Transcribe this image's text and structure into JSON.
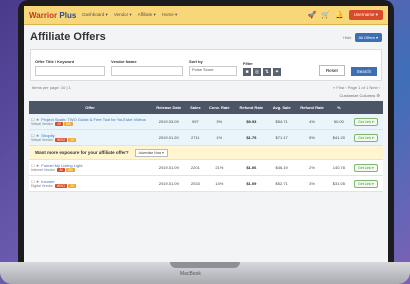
{
  "app": {
    "logo_part1": "Warrior",
    "logo_part2": "Plus",
    "nav": [
      "Dashboard ▾",
      "Vendor ▾",
      "Affiliate ▾",
      "Home ▾"
    ],
    "user_button": "Username ▾"
  },
  "page": {
    "title": "Affiliate Offers",
    "hide_label": "Hide",
    "all_offers_button": "All Offers ▾"
  },
  "filters": {
    "title_label": "Offer Title / Keyword",
    "vendor_label": "Vendor Name",
    "sort_label": "Sort by",
    "sort_value": "Pulse Score",
    "filter_label": "Filter",
    "filter_icons": [
      "■",
      "◎",
      "⇅",
      "✦"
    ],
    "reset_label": "Reset",
    "search_label": "Search"
  },
  "pager": {
    "left": "Items per page:  10  |  1",
    "right": "« First  ‹  Page 1 of 1  Next ›"
  },
  "column_toggle": "Customize Columns ⚙",
  "table": {
    "headers": [
      "Offer",
      "Release Date",
      "Sales",
      "Conv. Rate",
      "Refund Rate",
      "Avg. Sale",
      "Refund Rate",
      "%",
      ""
    ],
    "rows": [
      {
        "name": "Project Spark: TWO Guide & Free Tool for YouTube Videos",
        "vendor": "Virtual Vendor",
        "badges": [
          "JV",
          "SB"
        ],
        "cells": [
          "2019.03.09",
          "997",
          "3%",
          "$9.93",
          "$54.71",
          "4%",
          "50.00"
        ],
        "status": "Get Link ▾",
        "highlight": true
      },
      {
        "name": "Shopify",
        "vendor": "Virtual Vendor",
        "badges": [
          "WSO",
          "JV"
        ],
        "cells": [
          "2019.01.20",
          "2711",
          "1%",
          "$1.79",
          "$71.17",
          "5%",
          "$41.20"
        ],
        "status": "Get Link ▾",
        "highlight": true
      },
      {
        "name": "Funnel My Listing Light",
        "vendor": "Internet Vendor",
        "badges": [
          "JV",
          "SB"
        ],
        "cells": [
          "2019.01.09",
          "2201",
          "21%",
          "$1.06",
          "$46.19",
          "2%",
          "140.78"
        ],
        "status": "Get Link ▾",
        "highlight": false
      },
      {
        "name": "Income",
        "vendor": "Digital Vendor",
        "badges": [
          "WSO",
          "JV"
        ],
        "cells": [
          "2019.01.09",
          "2033",
          "14%",
          "$1.09",
          "$52.71",
          "3%",
          "$31.05"
        ],
        "status": "Get Link ▾",
        "highlight": false
      }
    ]
  },
  "promo": {
    "text": "Want more exposure for your affiliate offer?",
    "button": "Advertise Now ▾"
  },
  "device_label": "MacBook"
}
